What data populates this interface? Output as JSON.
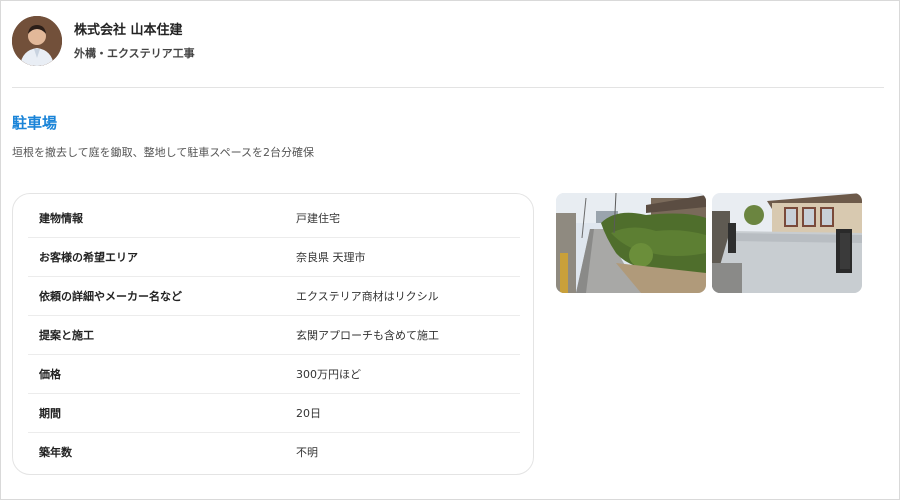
{
  "company": {
    "name": "株式会社 山本住建",
    "subtitle": "外構・エクステリア工事"
  },
  "case": {
    "title": "駐車場",
    "description": "垣根を撤去して庭を鋤取、整地して駐車スペースを2台分確保"
  },
  "info": [
    {
      "label": "建物情報",
      "value": "戸建住宅"
    },
    {
      "label": "お客様の希望エリア",
      "value": "奈良県 天理市"
    },
    {
      "label": "依頼の詳細やメーカー名など",
      "value": "エクステリア商材はリクシル"
    },
    {
      "label": "提案と施工",
      "value": "玄関アプローチも含めて施工"
    },
    {
      "label": "価格",
      "value": "300万円ほど"
    },
    {
      "label": "期間",
      "value": "20日"
    },
    {
      "label": "築年数",
      "value": "不明"
    }
  ],
  "colors": {
    "accent": "#1a84d8"
  },
  "photos": [
    {
      "name": "before-photo"
    },
    {
      "name": "after-photo"
    }
  ]
}
